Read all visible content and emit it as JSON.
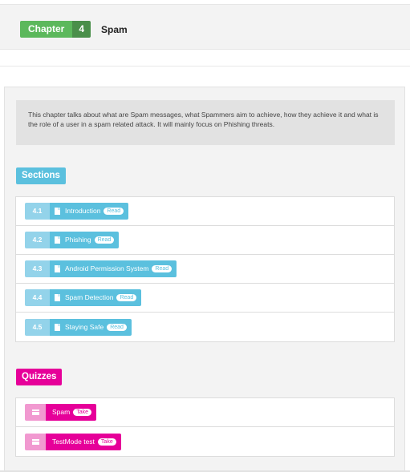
{
  "chapter": {
    "label": "Chapter",
    "number": "4",
    "title": "Spam"
  },
  "intro": {
    "text": "This chapter talks about what are Spam messages, what Spammers aim to achieve, how they achieve it and what is the role of a user in a spam related attack. It will mainly focus on Phishing threats."
  },
  "sections": {
    "heading": "Sections",
    "items": [
      {
        "num": "4.1",
        "label": "Introduction",
        "badge": "Read"
      },
      {
        "num": "4.2",
        "label": "Phishing",
        "badge": "Read"
      },
      {
        "num": "4.3",
        "label": "Android Permission System",
        "badge": "Read"
      },
      {
        "num": "4.4",
        "label": "Spam Detection",
        "badge": "Read"
      },
      {
        "num": "4.5",
        "label": "Staying Safe",
        "badge": "Read"
      }
    ]
  },
  "quizzes": {
    "heading": "Quizzes",
    "items": [
      {
        "label": "Spam",
        "badge": "Take"
      },
      {
        "label": "TestMode test",
        "badge": "Take"
      }
    ]
  },
  "colors": {
    "chapter_green": "#5cb85c",
    "section_blue": "#5bc0de",
    "quiz_magenta": "#e60099"
  },
  "icons": {
    "section_item": "document-icon",
    "quiz_item": "list-icon"
  }
}
